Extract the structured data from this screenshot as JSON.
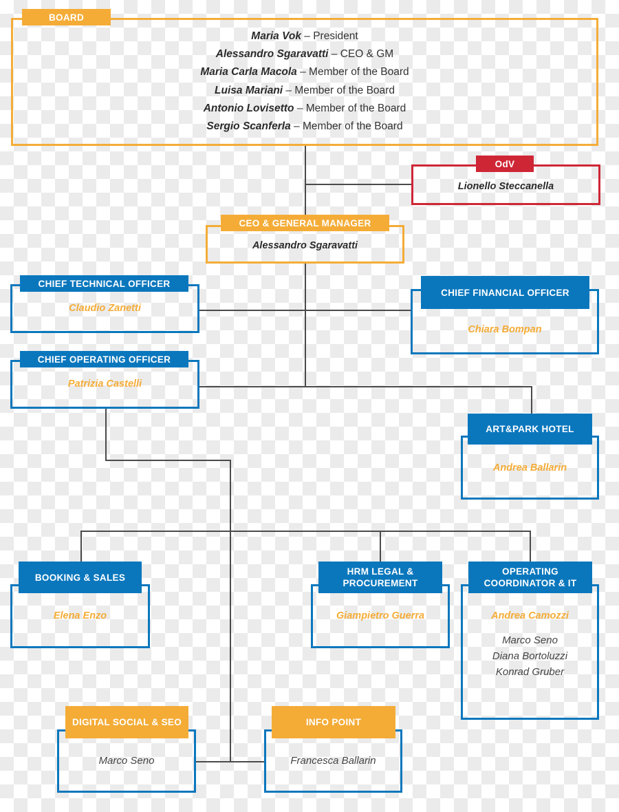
{
  "colors": {
    "orange": "#f4ac37",
    "blue": "#0a77bd",
    "red": "#cf2636",
    "connector": "#4a4a4a"
  },
  "board": {
    "title": "BOARD",
    "members": [
      {
        "name": "Maria Vok",
        "role": "– President"
      },
      {
        "name": "Alessandro Sgaravatti",
        "role": "– CEO & GM"
      },
      {
        "name": "Maria Carla Macola",
        "role": "– Member of the Board"
      },
      {
        "name": "Luisa Mariani",
        "role": "– Member of the Board"
      },
      {
        "name": "Antonio Lovisetto",
        "role": "– Member of the Board"
      },
      {
        "name": "Sergio Scanferla",
        "role": "– Member of the Board"
      }
    ]
  },
  "odv": {
    "title": "OdV",
    "name": "Lionello Steccanella"
  },
  "ceo": {
    "title": "CEO & GENERAL MANAGER",
    "name": "Alessandro Sgaravatti"
  },
  "cto": {
    "title": "CHIEF TECHNICAL OFFICER",
    "name": "Claudio Zanetti"
  },
  "cfo": {
    "title": "CHIEF FINANCIAL OFFICER",
    "name": "Chiara Bompan"
  },
  "coo": {
    "title": "CHIEF OPERATING OFFICER",
    "name": "Patrizia Castelli"
  },
  "hotel": {
    "title": "ART&PARK HOTEL",
    "name": "Andrea Ballarin"
  },
  "booking": {
    "title": "BOOKING & SALES",
    "name": "Elena Enzo"
  },
  "hrm": {
    "title_line1": "HRM LEGAL &",
    "title_line2": "PROCUREMENT",
    "name": "Giampietro Guerra"
  },
  "opcoord": {
    "title_line1": "OPERATING",
    "title_line2": "COORDINATOR & IT",
    "name": "Andrea Camozzi",
    "staff": [
      "Marco Seno",
      "Diana Bortoluzzi",
      "Konrad Gruber"
    ]
  },
  "digital": {
    "title": "DIGITAL SOCIAL & SEO",
    "name": "Marco Seno"
  },
  "infopoint": {
    "title": "INFO POINT",
    "name": "Francesca Ballarin"
  }
}
